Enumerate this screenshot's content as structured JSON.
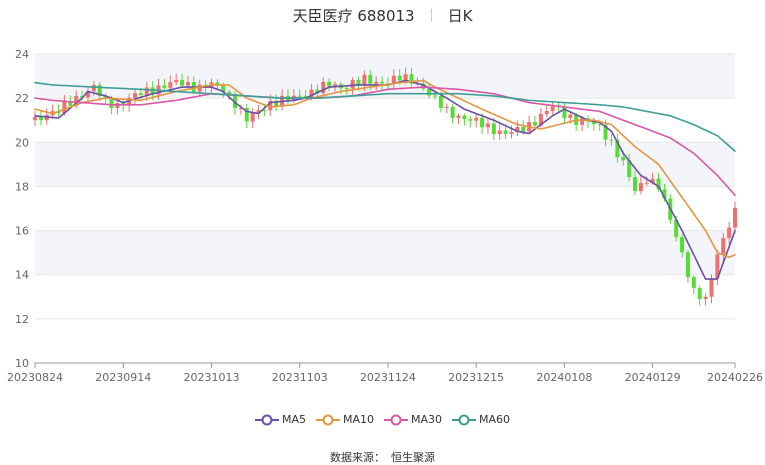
{
  "header": {
    "stock": "天臣医疗 688013",
    "period": "日K"
  },
  "footer": {
    "label": "数据来源：",
    "provider": "恒生聚源"
  },
  "chart_data": {
    "type": "candlestick",
    "ylim": [
      10,
      24
    ],
    "yticks": [
      10,
      12,
      14,
      16,
      18,
      20,
      22,
      24
    ],
    "xtick_labels": [
      "20230824",
      "20230914",
      "20231013",
      "20231103",
      "20231124",
      "20231215",
      "20240108",
      "20240129",
      "20240226"
    ],
    "xtick_index": [
      0,
      15,
      30,
      45,
      60,
      75,
      90,
      105,
      119
    ],
    "up_color": "#f07070",
    "down_color": "#55dd33",
    "shaded_bands": [
      [
        14,
        16
      ],
      [
        18,
        20
      ],
      [
        22,
        24
      ]
    ],
    "series": [
      {
        "name": "MA5",
        "color": "#6a4fa8",
        "keys": [
          [
            0,
            21.2
          ],
          [
            4,
            21.1
          ],
          [
            8,
            22.0
          ],
          [
            9,
            22.3
          ],
          [
            12,
            22.1
          ],
          [
            15,
            21.8
          ],
          [
            20,
            22.2
          ],
          [
            25,
            22.5
          ],
          [
            30,
            22.5
          ],
          [
            32,
            22.3
          ],
          [
            34,
            21.8
          ],
          [
            36,
            21.4
          ],
          [
            38,
            21.3
          ],
          [
            40,
            21.8
          ],
          [
            44,
            21.9
          ],
          [
            46,
            22.0
          ],
          [
            50,
            22.5
          ],
          [
            55,
            22.6
          ],
          [
            60,
            22.6
          ],
          [
            63,
            22.8
          ],
          [
            66,
            22.6
          ],
          [
            70,
            22.0
          ],
          [
            73,
            21.5
          ],
          [
            78,
            21.0
          ],
          [
            82,
            20.5
          ],
          [
            84,
            20.4
          ],
          [
            88,
            21.2
          ],
          [
            90,
            21.5
          ],
          [
            94,
            21.0
          ],
          [
            96,
            20.9
          ],
          [
            98,
            20.5
          ],
          [
            100,
            19.5
          ],
          [
            103,
            18.5
          ],
          [
            106,
            18.0
          ],
          [
            110,
            16.0
          ],
          [
            114,
            13.8
          ],
          [
            116,
            13.8
          ],
          [
            119,
            16.0
          ]
        ]
      },
      {
        "name": "MA10",
        "color": "#e69542",
        "keys": [
          [
            0,
            21.5
          ],
          [
            3,
            21.3
          ],
          [
            8,
            21.8
          ],
          [
            12,
            22.0
          ],
          [
            18,
            21.9
          ],
          [
            24,
            22.3
          ],
          [
            30,
            22.6
          ],
          [
            33,
            22.6
          ],
          [
            36,
            22.0
          ],
          [
            40,
            21.6
          ],
          [
            44,
            21.7
          ],
          [
            47,
            22.0
          ],
          [
            52,
            22.3
          ],
          [
            57,
            22.5
          ],
          [
            62,
            22.7
          ],
          [
            66,
            22.8
          ],
          [
            68,
            22.5
          ],
          [
            72,
            22.0
          ],
          [
            76,
            21.5
          ],
          [
            82,
            20.8
          ],
          [
            86,
            20.6
          ],
          [
            92,
            21.0
          ],
          [
            95,
            21.0
          ],
          [
            98,
            20.8
          ],
          [
            102,
            19.8
          ],
          [
            106,
            19.0
          ],
          [
            110,
            17.5
          ],
          [
            114,
            16.0
          ],
          [
            116,
            15.0
          ],
          [
            118,
            14.8
          ],
          [
            119,
            14.9
          ]
        ]
      },
      {
        "name": "MA30",
        "color": "#d957a7",
        "keys": [
          [
            0,
            22.0
          ],
          [
            3,
            21.9
          ],
          [
            8,
            21.8
          ],
          [
            13,
            21.7
          ],
          [
            18,
            21.7
          ],
          [
            24,
            21.9
          ],
          [
            30,
            22.2
          ],
          [
            36,
            22.1
          ],
          [
            42,
            22.0
          ],
          [
            48,
            22.0
          ],
          [
            54,
            22.1
          ],
          [
            60,
            22.4
          ],
          [
            66,
            22.5
          ],
          [
            72,
            22.4
          ],
          [
            78,
            22.2
          ],
          [
            84,
            21.8
          ],
          [
            90,
            21.6
          ],
          [
            96,
            21.4
          ],
          [
            100,
            21.0
          ],
          [
            104,
            20.6
          ],
          [
            108,
            20.2
          ],
          [
            112,
            19.5
          ],
          [
            116,
            18.5
          ],
          [
            119,
            17.6
          ]
        ]
      },
      {
        "name": "MA60",
        "color": "#3e9e96",
        "keys": [
          [
            0,
            22.7
          ],
          [
            3,
            22.6
          ],
          [
            10,
            22.5
          ],
          [
            18,
            22.4
          ],
          [
            24,
            22.3
          ],
          [
            30,
            22.2
          ],
          [
            36,
            22.1
          ],
          [
            42,
            22.0
          ],
          [
            48,
            22.0
          ],
          [
            54,
            22.1
          ],
          [
            60,
            22.2
          ],
          [
            66,
            22.2
          ],
          [
            72,
            22.2
          ],
          [
            78,
            22.1
          ],
          [
            84,
            21.9
          ],
          [
            90,
            21.8
          ],
          [
            96,
            21.7
          ],
          [
            100,
            21.6
          ],
          [
            104,
            21.4
          ],
          [
            108,
            21.2
          ],
          [
            112,
            20.8
          ],
          [
            116,
            20.3
          ],
          [
            119,
            19.6
          ]
        ]
      }
    ],
    "close_keys": [
      [
        0,
        21.0
      ],
      [
        2,
        21.3
      ],
      [
        4,
        21.4
      ],
      [
        6,
        21.8
      ],
      [
        8,
        22.2
      ],
      [
        10,
        22.5
      ],
      [
        12,
        21.8
      ],
      [
        14,
        21.7
      ],
      [
        16,
        22.0
      ],
      [
        18,
        22.2
      ],
      [
        20,
        22.4
      ],
      [
        22,
        22.6
      ],
      [
        24,
        22.7
      ],
      [
        26,
        22.6
      ],
      [
        28,
        22.5
      ],
      [
        30,
        22.6
      ],
      [
        32,
        22.4
      ],
      [
        34,
        21.8
      ],
      [
        36,
        21.0
      ],
      [
        38,
        21.4
      ],
      [
        40,
        21.8
      ],
      [
        42,
        21.9
      ],
      [
        44,
        22.0
      ],
      [
        46,
        22.2
      ],
      [
        48,
        22.4
      ],
      [
        50,
        22.6
      ],
      [
        52,
        22.5
      ],
      [
        54,
        22.7
      ],
      [
        56,
        22.8
      ],
      [
        58,
        22.7
      ],
      [
        60,
        22.8
      ],
      [
        62,
        22.9
      ],
      [
        64,
        22.8
      ],
      [
        66,
        22.5
      ],
      [
        68,
        21.9
      ],
      [
        70,
        21.4
      ],
      [
        72,
        21.2
      ],
      [
        74,
        21.0
      ],
      [
        76,
        20.8
      ],
      [
        78,
        20.6
      ],
      [
        80,
        20.4
      ],
      [
        82,
        20.5
      ],
      [
        84,
        20.8
      ],
      [
        86,
        21.2
      ],
      [
        88,
        21.6
      ],
      [
        90,
        21.3
      ],
      [
        92,
        21.0
      ],
      [
        94,
        20.9
      ],
      [
        96,
        20.7
      ],
      [
        98,
        20.0
      ],
      [
        100,
        19.0
      ],
      [
        102,
        17.8
      ],
      [
        104,
        18.4
      ],
      [
        106,
        18.0
      ],
      [
        108,
        16.5
      ],
      [
        110,
        15.0
      ],
      [
        112,
        13.2
      ],
      [
        114,
        12.8
      ],
      [
        116,
        15.0
      ],
      [
        118,
        16.3
      ],
      [
        119,
        16.8
      ]
    ]
  }
}
